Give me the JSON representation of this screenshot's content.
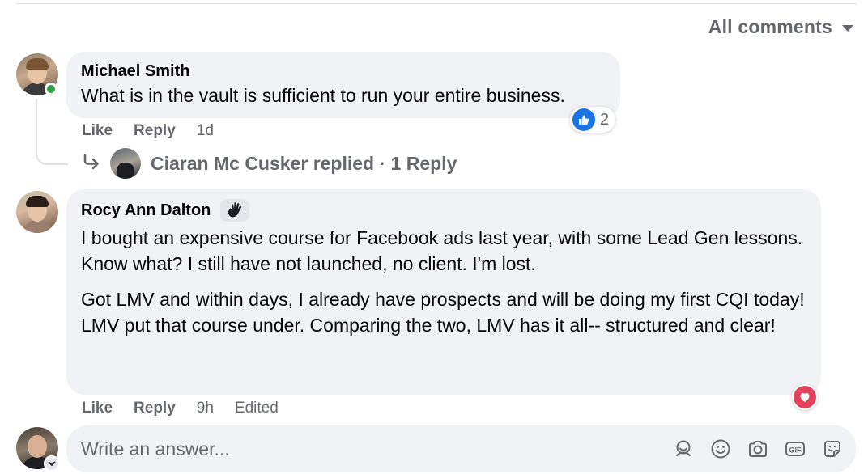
{
  "sort": {
    "label": "All comments",
    "icon": "caret-down-icon"
  },
  "comments": [
    {
      "author": "Michael Smith",
      "text": "What is in the vault is sufficient to run your entire business.",
      "reaction": {
        "icon": "like-reaction-icon",
        "count": "2"
      },
      "actions": {
        "like": "Like",
        "reply": "Reply",
        "time": "1d"
      },
      "replies": {
        "text": "Ciaran Mc Cusker replied · 1 Reply"
      }
    },
    {
      "author": "Rocy Ann Dalton",
      "badge_icon": "rising-fan-hand-icon",
      "paragraphs": [
        "I bought an expensive course for Facebook ads last year, with some Lead Gen lessons. Know what? I still have not launched, no client. I'm lost.",
        "Got LMV and within days, I already have prospects and will be doing my first CQI today!\nLMV put that course under. Comparing the two, LMV has it all-- structured and clear!"
      ],
      "reaction": {
        "icon": "love-reaction-icon"
      },
      "actions": {
        "like": "Like",
        "reply": "Reply",
        "time": "9h",
        "edited": "Edited"
      }
    }
  ],
  "composer": {
    "placeholder": "Write an answer...",
    "tools": [
      "avatar-sticker-icon",
      "emoji-icon",
      "camera-icon",
      "gif-icon",
      "sticker-icon"
    ]
  },
  "colors": {
    "accent": "#1b74e4",
    "love": "#e4415d",
    "online": "#31a24c",
    "bubble": "#f0f2f5",
    "muted": "#65676b"
  }
}
